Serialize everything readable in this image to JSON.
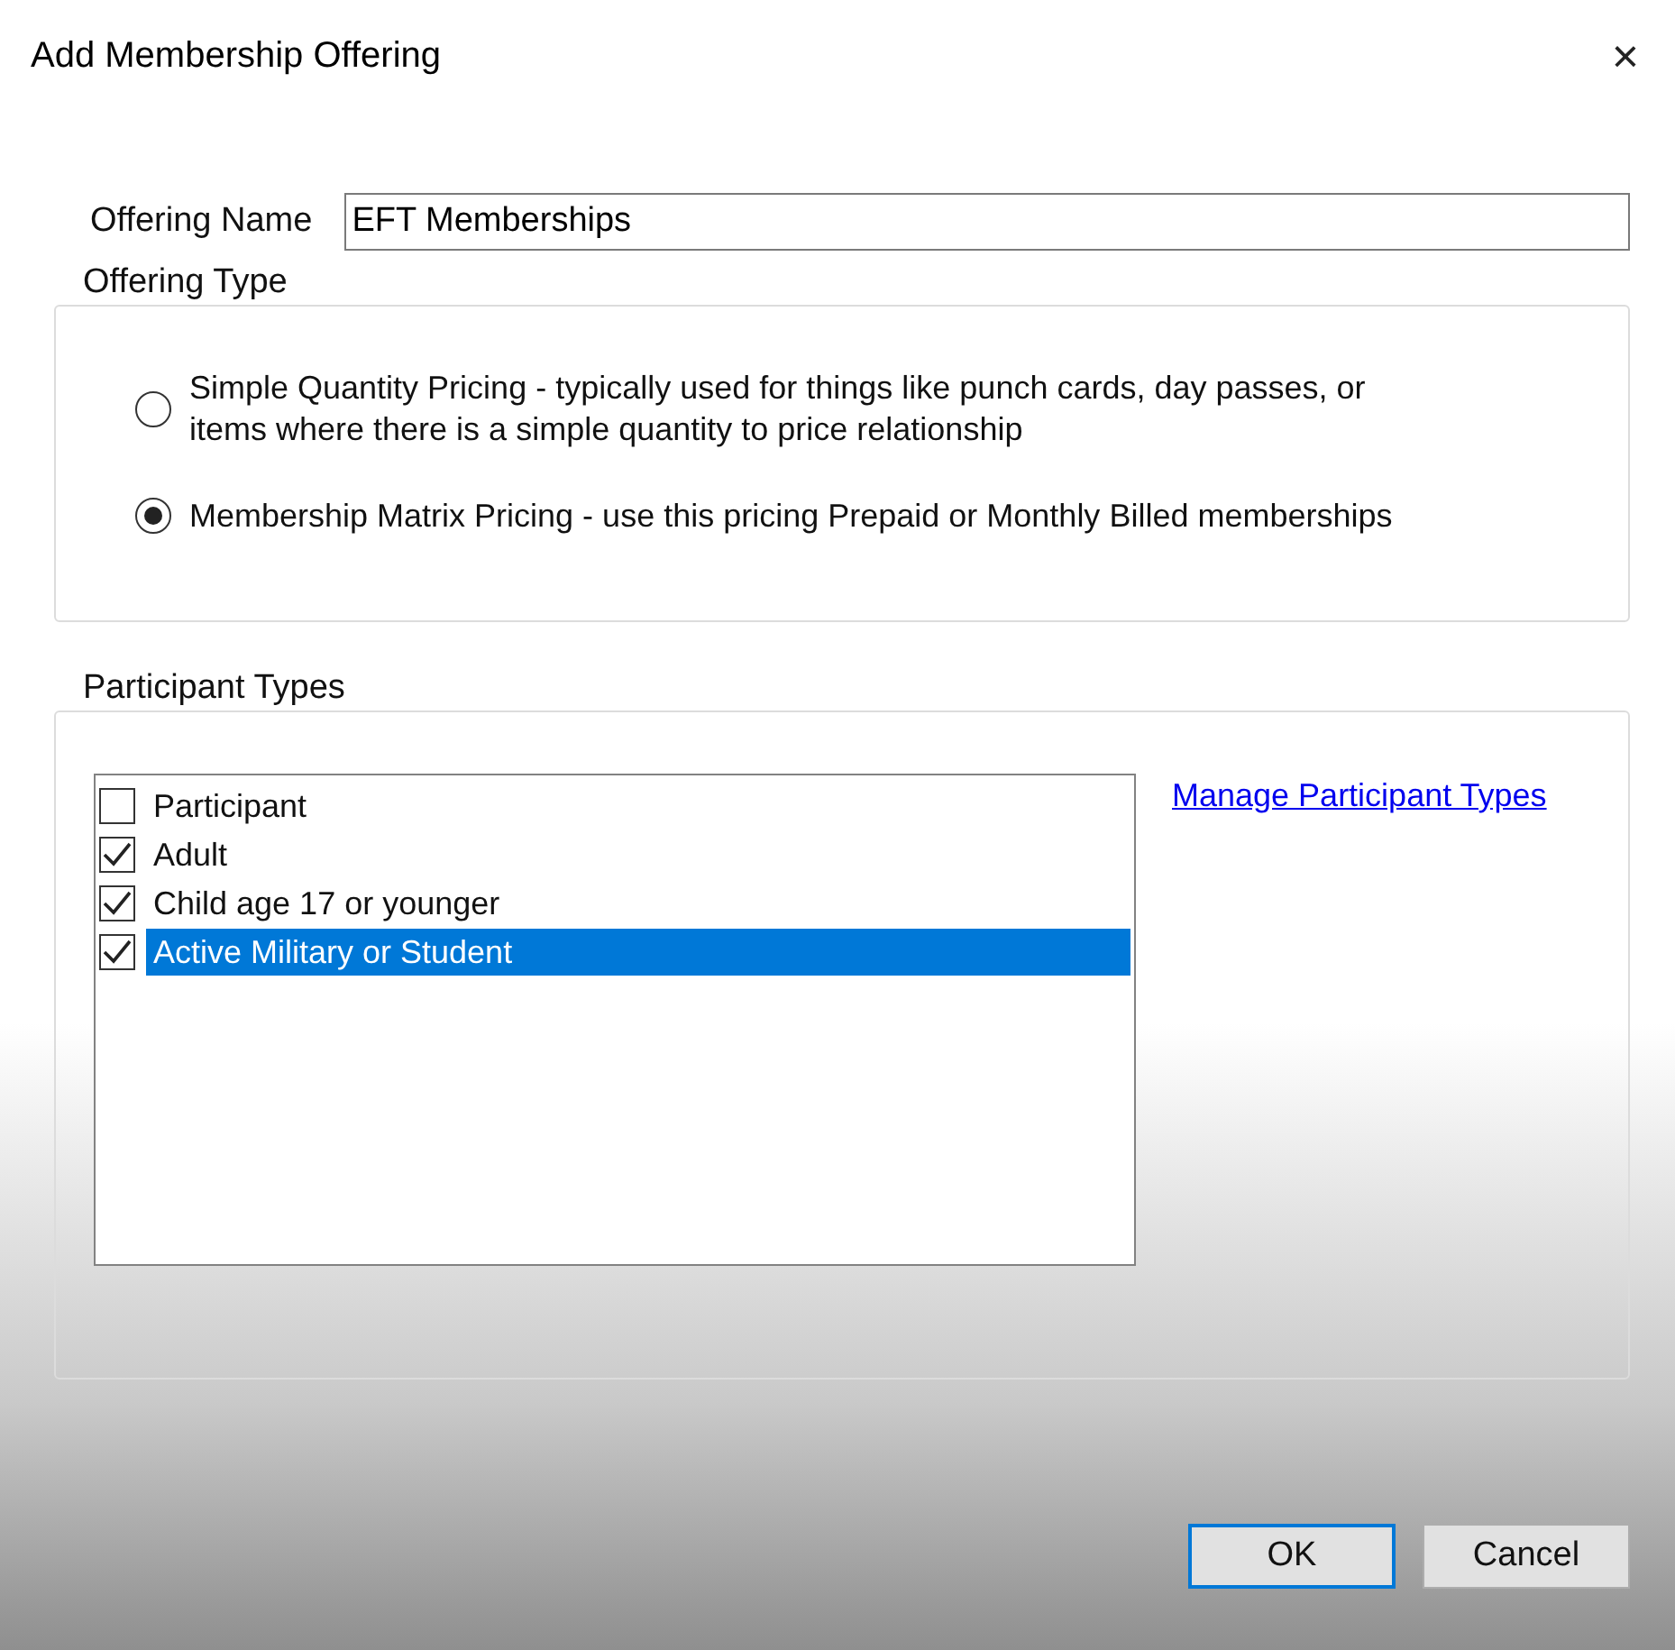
{
  "window": {
    "title": "Add Membership Offering",
    "close": "×"
  },
  "offering_name": {
    "label": "Offering Name",
    "value": "EFT Memberships"
  },
  "offering_type": {
    "title": "Offering Type",
    "options": [
      {
        "label": "Simple Quantity Pricing - typically used for things like punch cards, day passes, or items where there is a simple quantity to price relationship",
        "selected": false
      },
      {
        "label": "Membership Matrix Pricing - use this pricing Prepaid or Monthly Billed memberships",
        "selected": true
      }
    ]
  },
  "participant_types": {
    "title": "Participant Types",
    "link": "Manage Participant Types",
    "items": [
      {
        "label": "Participant",
        "checked": false,
        "selected": false
      },
      {
        "label": "Adult",
        "checked": true,
        "selected": false
      },
      {
        "label": "Child age 17 or younger",
        "checked": true,
        "selected": false
      },
      {
        "label": "Active Military or Student",
        "checked": true,
        "selected": true
      }
    ]
  },
  "buttons": [
    {
      "label": "OK",
      "default": true
    },
    {
      "label": "Cancel",
      "default": false
    }
  ]
}
